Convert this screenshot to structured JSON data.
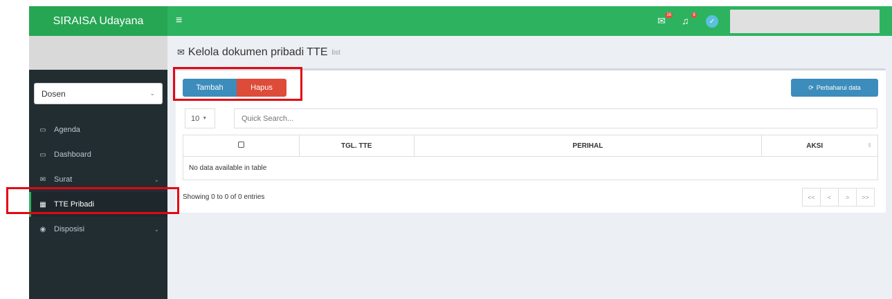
{
  "app": {
    "title": "SIRAISA Udayana"
  },
  "topbar": {
    "menu_glyph": "≡",
    "mail_badge": "16",
    "bell_badge": "8"
  },
  "sidebar": {
    "role": "Dosen",
    "items": [
      {
        "label": "Agenda",
        "icon": "calendar-icon",
        "glyph": "▭",
        "submenu": false,
        "active": false
      },
      {
        "label": "Dashboard",
        "icon": "monitor-icon",
        "glyph": "▭",
        "submenu": false,
        "active": false
      },
      {
        "label": "Surat",
        "icon": "envelope-icon",
        "glyph": "✉",
        "submenu": true,
        "active": false
      },
      {
        "label": "TTE Pribadi",
        "icon": "calendar-icon",
        "glyph": "▦",
        "submenu": false,
        "active": true
      },
      {
        "label": "Disposisi",
        "icon": "eye-icon",
        "glyph": "◉",
        "submenu": true,
        "active": false
      }
    ]
  },
  "content": {
    "title": "Kelola dokumen pribadi TTE",
    "subtitle": "list",
    "buttons": {
      "add": "Tambah",
      "delete": "Hapus",
      "refresh": "Perbaharui data"
    },
    "page_length": "10",
    "search_placeholder": "Quick Search...",
    "table": {
      "columns": [
        "",
        "TGL. TTE",
        "PERIHAL",
        "AKSI"
      ],
      "empty_text": "No data available in table"
    },
    "info": "Showing 0 to 0 of 0 entries",
    "pager": [
      "<<",
      "<",
      ">",
      ">>"
    ]
  },
  "colors": {
    "topbar": "#2db35f",
    "logo": "#26a653",
    "sidebar": "#222d32",
    "primary": "#3c8dbc",
    "danger": "#dd4b39",
    "highlight": "#e30613"
  }
}
